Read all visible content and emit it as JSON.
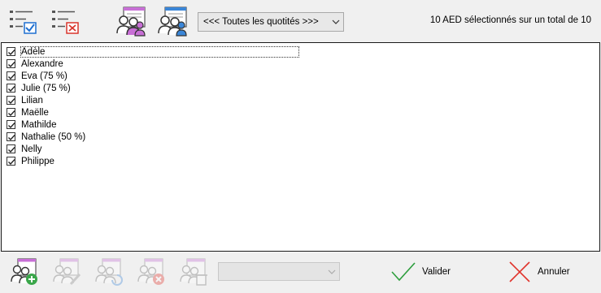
{
  "toolbar": {
    "select_all_icon": "checklist-check-icon",
    "deselect_all_icon": "checklist-cross-icon",
    "women_icon": "people-female-icon",
    "men_icon": "people-male-icon",
    "filter_value": "<<< Toutes les quotités >>>"
  },
  "status_text": "10 AED sélectionnés sur un total de 10",
  "list": {
    "items": [
      {
        "label": "Adèle",
        "checked": true
      },
      {
        "label": "Alexandre",
        "checked": true
      },
      {
        "label": "Eva (75 %)",
        "checked": true
      },
      {
        "label": "Julie (75 %)",
        "checked": true
      },
      {
        "label": "Lilian",
        "checked": true
      },
      {
        "label": "Maëlle",
        "checked": true
      },
      {
        "label": "Mathilde",
        "checked": true
      },
      {
        "label": "Nathalie (50 %)",
        "checked": true
      },
      {
        "label": "Nelly",
        "checked": true
      },
      {
        "label": "Philippe",
        "checked": true
      }
    ]
  },
  "bottom": {
    "add_icon": "people-add-icon",
    "edit_icon": "people-edit-icon",
    "refresh_icon": "people-refresh-icon",
    "remove_icon": "people-remove-icon",
    "delete_icon": "people-delete-icon",
    "select_value": "",
    "validate_label": "Valider",
    "cancel_label": "Annuler"
  },
  "colors": {
    "check_blue": "#1e6fd0",
    "cross_red": "#d9342b",
    "female_accent": "#c86fd6",
    "male_accent": "#3a86d8",
    "add_green": "#3aa64a",
    "validate_green": "#2e9e3e",
    "cancel_red": "#e0332b"
  }
}
